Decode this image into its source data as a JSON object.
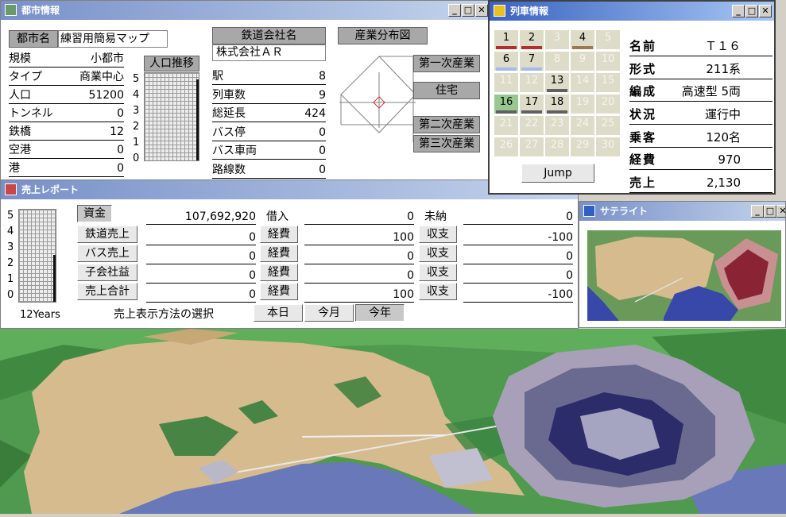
{
  "city_window": {
    "title": "都市情報",
    "city_name_label": "都市名",
    "city_name_value": "練習用簡易マップ",
    "stats": [
      {
        "label": "規模",
        "value": "小都市"
      },
      {
        "label": "タイプ",
        "value": "商業中心"
      },
      {
        "label": "人口",
        "value": "51200"
      },
      {
        "label": "トンネル",
        "value": "0"
      },
      {
        "label": "鉄橋",
        "value": "12"
      },
      {
        "label": "空港",
        "value": "0"
      },
      {
        "label": "港",
        "value": "0"
      }
    ],
    "population_chart": {
      "title": "人口推移",
      "axis": [
        "5",
        "4",
        "3",
        "2",
        "1",
        "0"
      ]
    },
    "company_label": "鉄道会社名",
    "company_value": "株式会社ＡＲ",
    "railway_stats": [
      {
        "label": "駅",
        "value": "8"
      },
      {
        "label": "列車数",
        "value": "9"
      },
      {
        "label": "総延長",
        "value": "424"
      },
      {
        "label": "バス停",
        "value": "0"
      },
      {
        "label": "バス車両",
        "value": "0"
      },
      {
        "label": "路線数",
        "value": "0"
      }
    ],
    "industry": {
      "title": "産業分布図",
      "labels": [
        "第一次産業",
        "住宅",
        "第二次産業",
        "第三次産業"
      ]
    }
  },
  "train_window": {
    "title": "列車情報",
    "cells": [
      {
        "n": "1",
        "active": true,
        "bar": "#b03030"
      },
      {
        "n": "2",
        "active": true,
        "bar": "#b03030"
      },
      {
        "n": "3",
        "active": false,
        "bar": ""
      },
      {
        "n": "4",
        "active": true,
        "bar": "#9a7850"
      },
      {
        "n": "5",
        "active": false,
        "bar": ""
      },
      {
        "n": "6",
        "active": true,
        "bar": "#a8b8e8"
      },
      {
        "n": "7",
        "active": true,
        "bar": "#a8b8e8"
      },
      {
        "n": "8",
        "active": false,
        "bar": ""
      },
      {
        "n": "9",
        "active": false,
        "bar": ""
      },
      {
        "n": "10",
        "active": false,
        "bar": ""
      },
      {
        "n": "11",
        "active": false,
        "bar": ""
      },
      {
        "n": "12",
        "active": false,
        "bar": ""
      },
      {
        "n": "13",
        "active": true,
        "bar": "#606060"
      },
      {
        "n": "14",
        "active": false,
        "bar": ""
      },
      {
        "n": "15",
        "active": false,
        "bar": ""
      },
      {
        "n": "16",
        "active": true,
        "bar": "#606060",
        "bg": "#98c890"
      },
      {
        "n": "17",
        "active": true,
        "bar": "#606060"
      },
      {
        "n": "18",
        "active": true,
        "bar": "#606060"
      },
      {
        "n": "19",
        "active": false,
        "bar": ""
      },
      {
        "n": "20",
        "active": false,
        "bar": ""
      },
      {
        "n": "21",
        "active": false,
        "bar": ""
      },
      {
        "n": "22",
        "active": false,
        "bar": ""
      },
      {
        "n": "23",
        "active": false,
        "bar": ""
      },
      {
        "n": "24",
        "active": false,
        "bar": ""
      },
      {
        "n": "25",
        "active": false,
        "bar": ""
      },
      {
        "n": "26",
        "active": false,
        "bar": ""
      },
      {
        "n": "27",
        "active": false,
        "bar": ""
      },
      {
        "n": "28",
        "active": false,
        "bar": ""
      },
      {
        "n": "29",
        "active": false,
        "bar": ""
      },
      {
        "n": "30",
        "active": false,
        "bar": ""
      }
    ],
    "jump_label": "Jump",
    "info": [
      {
        "label": "名前",
        "value": "Ｔ１６"
      },
      {
        "label": "形式",
        "value": "211系"
      },
      {
        "label": "編成",
        "value": "高速型 5両"
      },
      {
        "label": "状況",
        "value": "運行中"
      },
      {
        "label": "乗客",
        "value": "120名"
      },
      {
        "label": "経費",
        "value": "970"
      },
      {
        "label": "売上",
        "value": "2,130"
      }
    ]
  },
  "sales_window": {
    "title": "売上レポート",
    "chart_axis": [
      "5",
      "4",
      "3",
      "2",
      "1",
      "0"
    ],
    "chart_caption": "12Years",
    "capital_label": "資金",
    "capital_value": "107,692,920",
    "rows": [
      {
        "label": "鉄道売上",
        "value": "0",
        "cost_label": "経費",
        "cost": "100",
        "bal_label": "収支",
        "bal": "-100"
      },
      {
        "label": "バス売上",
        "value": "0",
        "cost_label": "経費",
        "cost": "0",
        "bal_label": "収支",
        "bal": "0"
      },
      {
        "label": "子会社益",
        "value": "0",
        "cost_label": "経費",
        "cost": "0",
        "bal_label": "収支",
        "bal": "0"
      },
      {
        "label": "売上合計",
        "value": "0",
        "cost_label": "経費",
        "cost": "100",
        "bal_label": "収支",
        "bal": "-100"
      }
    ],
    "loan_label": "借入",
    "loan_value": "0",
    "unpaid_label": "未納",
    "unpaid_value": "0",
    "period_label": "売上表示方法の選択",
    "periods": [
      "本日",
      "今月",
      "今年"
    ]
  },
  "satellite_window": {
    "title": "サテライト"
  },
  "colors": {
    "titlebar_active": "#3a62c0",
    "sand": "#d6bb8e",
    "water": "#6878b8",
    "grass": "#58a858"
  }
}
